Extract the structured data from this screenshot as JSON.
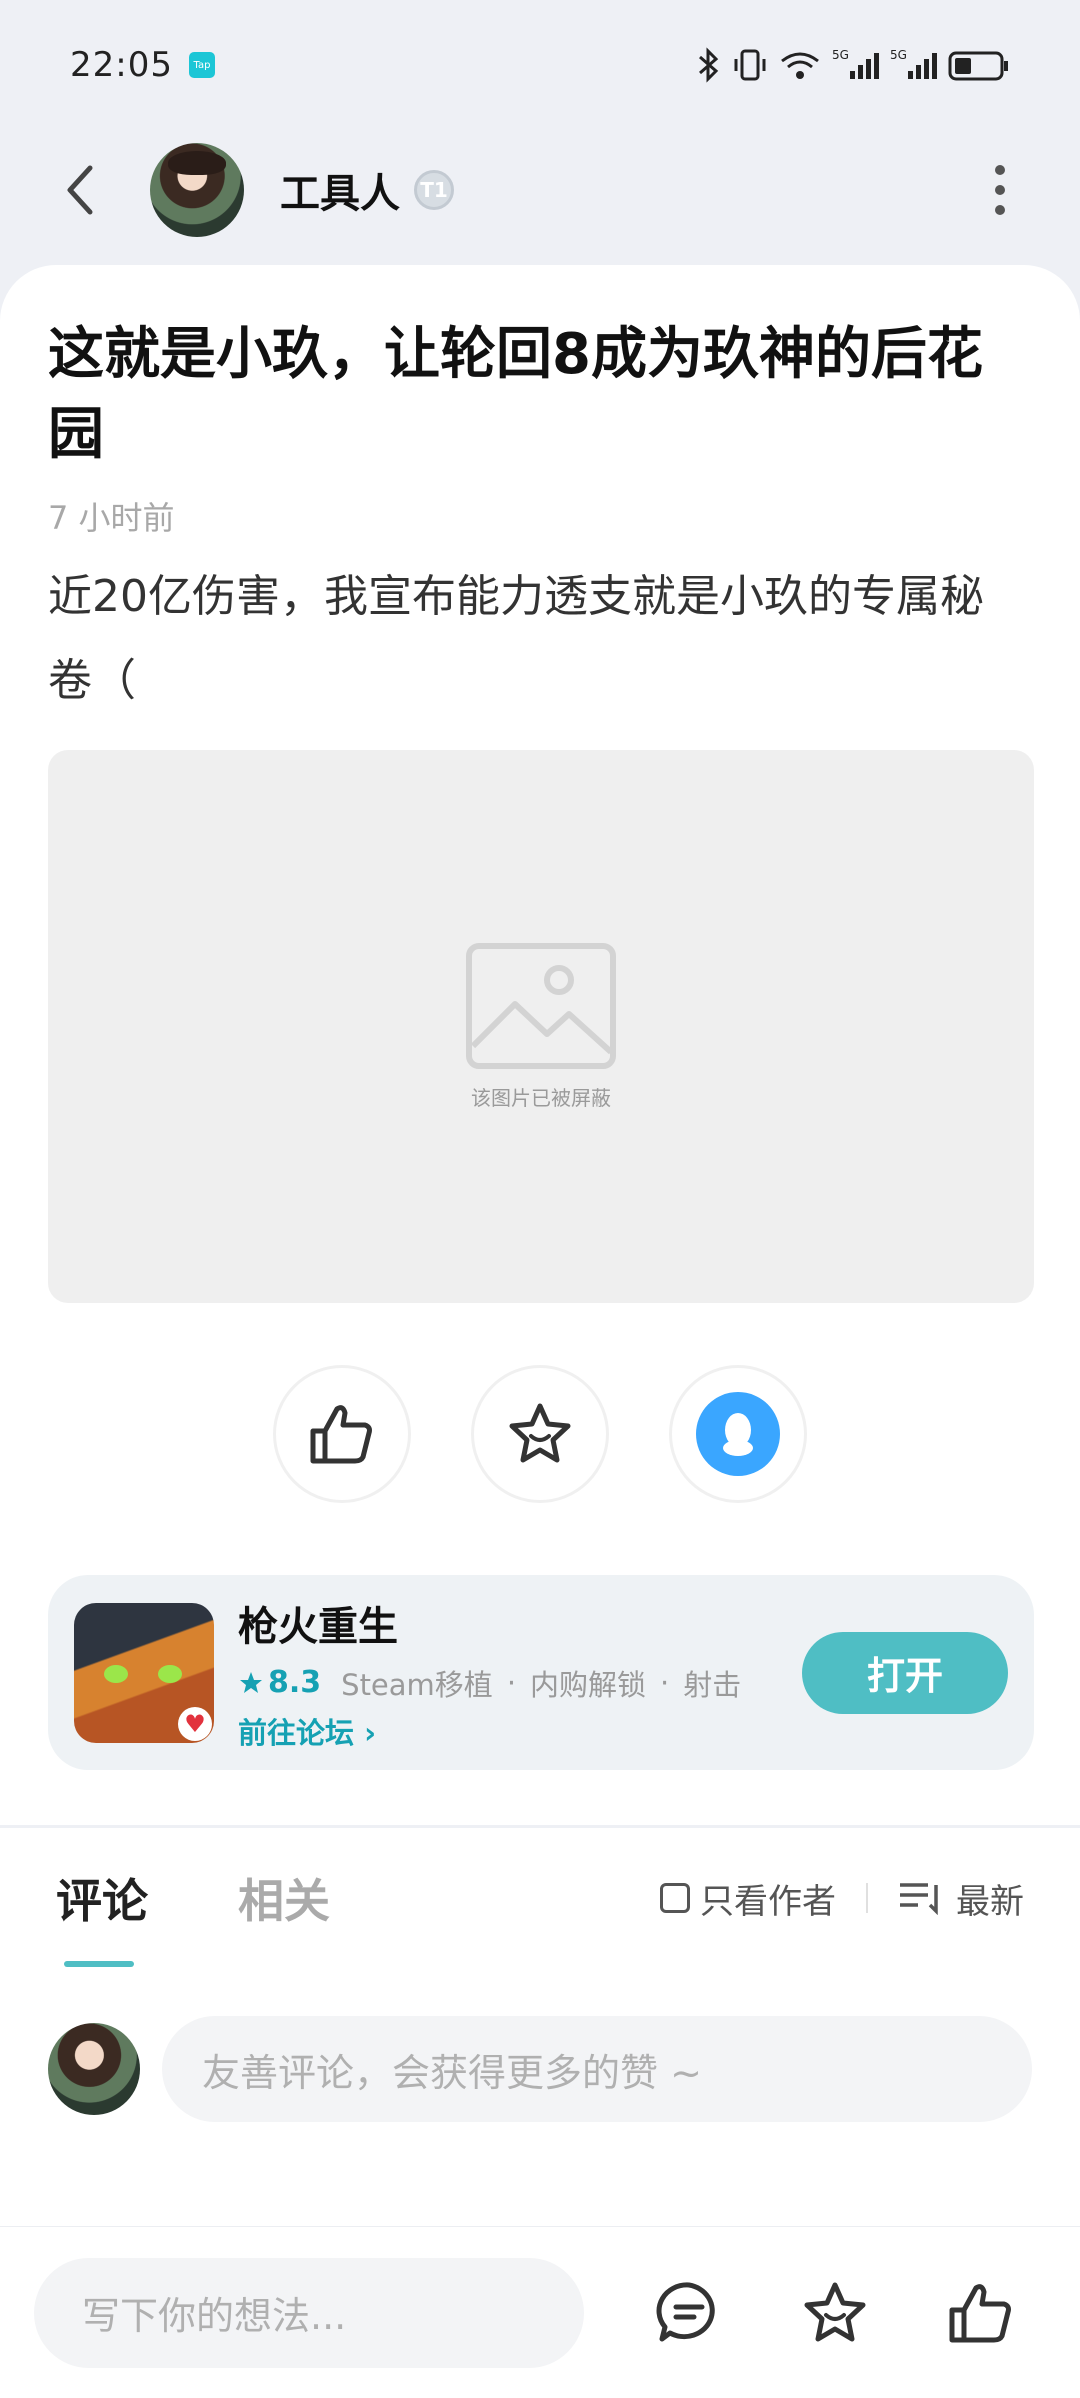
{
  "status_bar": {
    "time": "22:05",
    "app_badge": "Tap"
  },
  "header": {
    "author_name": "工具人",
    "level_badge": "T1"
  },
  "post": {
    "title": "这就是小玖，让轮回8成为玖神的后花园",
    "time": "7 小时前",
    "body": "近20亿伤害，我宣布能力透支就是小玖的专属秘卷（",
    "image_blocked_text": "该图片已被屏蔽"
  },
  "game": {
    "name": "枪火重生",
    "score": "8.3",
    "tags": [
      "Steam移植",
      "内购解锁",
      "射击"
    ],
    "forum_link": "前往论坛",
    "open_label": "打开"
  },
  "comments": {
    "tabs": [
      "评论",
      "相关"
    ],
    "only_author_label": "只看作者",
    "sort_label": "最新",
    "input_placeholder": "友善评论，会获得更多的赞 ~"
  },
  "bottom_bar": {
    "write_placeholder": "写下你的想法..."
  },
  "colors": {
    "accent": "#4fbec4",
    "score": "#15a1b3",
    "qq": "#3aa6ff"
  }
}
